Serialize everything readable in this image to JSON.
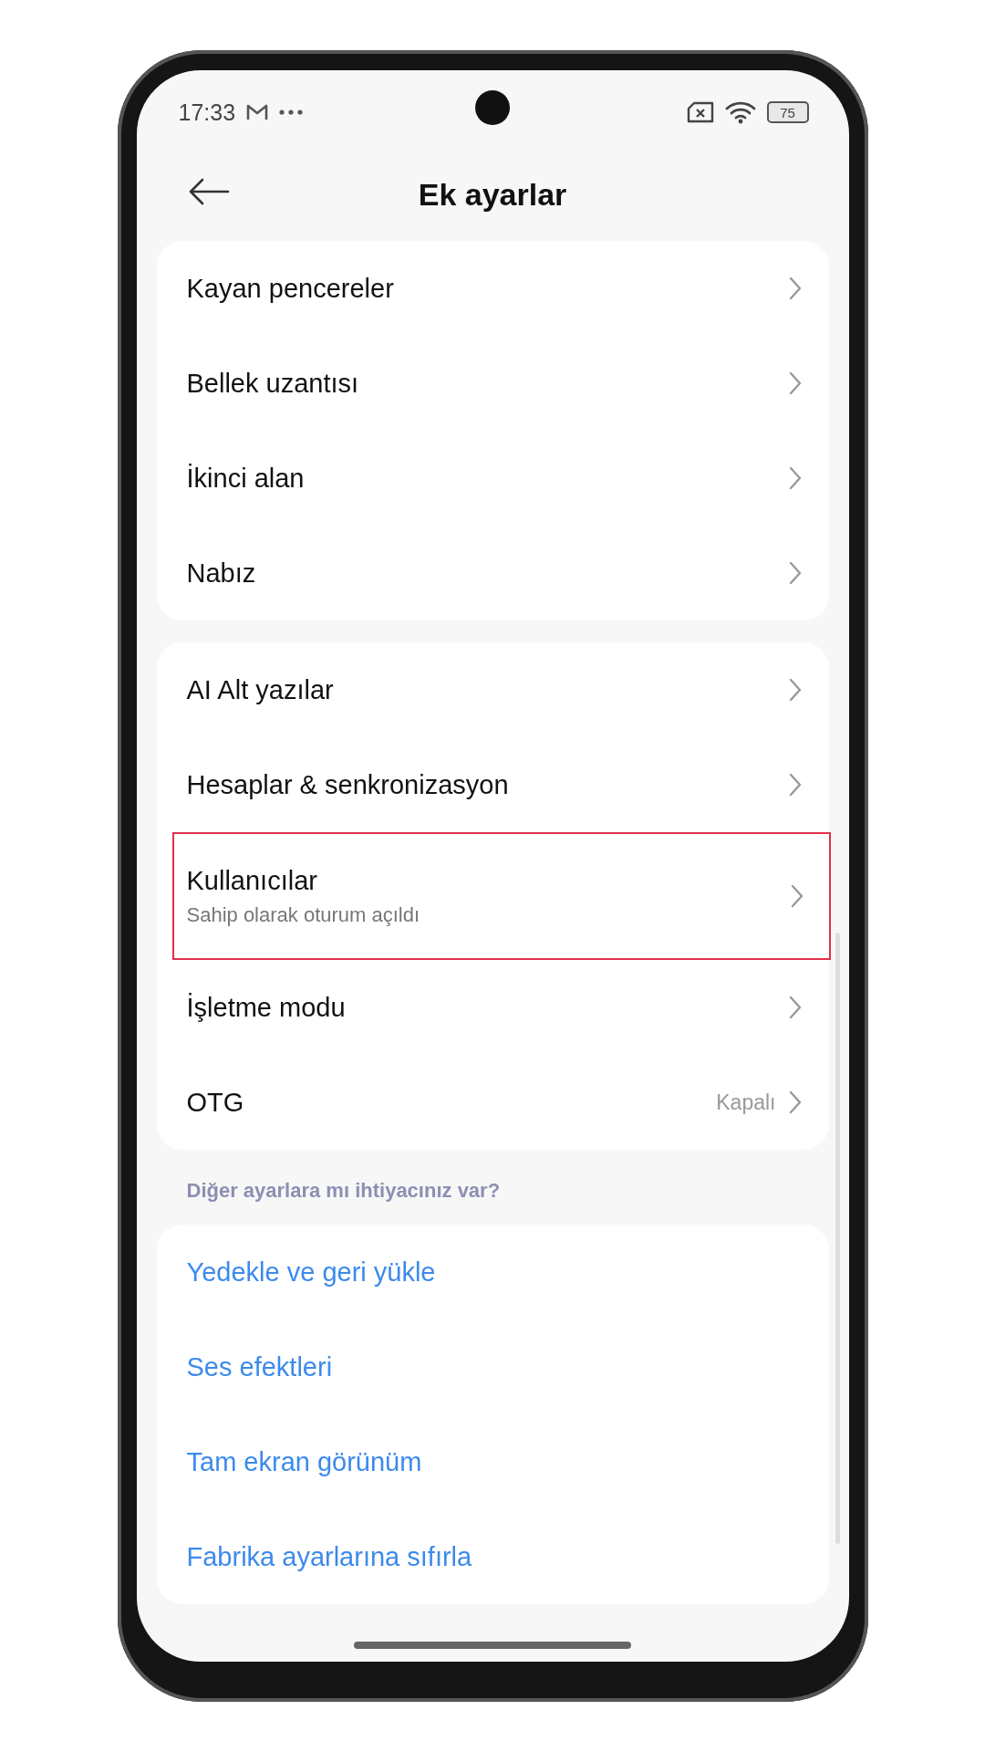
{
  "status_bar": {
    "time": "17:33",
    "battery": "75"
  },
  "header": {
    "title": "Ek ayarlar"
  },
  "groups": [
    {
      "items": [
        {
          "kind": "nav",
          "label": "Kayan pencereler",
          "highlighted": false
        },
        {
          "kind": "nav",
          "label": "Bellek uzantısı",
          "highlighted": false
        },
        {
          "kind": "nav",
          "label": "İkinci alan",
          "highlighted": false
        },
        {
          "kind": "nav",
          "label": "Nabız",
          "highlighted": false
        }
      ]
    },
    {
      "items": [
        {
          "kind": "nav",
          "label": "AI Alt yazılar",
          "highlighted": false
        },
        {
          "kind": "nav",
          "label": "Hesaplar & senkronizasyon",
          "highlighted": false
        },
        {
          "kind": "nav",
          "label": "Kullanıcılar",
          "subtitle": "Sahip olarak oturum açıldı",
          "highlighted": true
        },
        {
          "kind": "nav",
          "label": "İşletme modu",
          "highlighted": false
        },
        {
          "kind": "nav",
          "label": "OTG",
          "value": "Kapalı",
          "highlighted": false
        }
      ]
    },
    {
      "heading": "Diğer ayarlara mı ihtiyacınız var?",
      "items": [
        {
          "kind": "link",
          "label": "Yedekle ve geri yükle",
          "highlighted": false
        },
        {
          "kind": "link",
          "label": "Ses efektleri",
          "highlighted": false
        },
        {
          "kind": "link",
          "label": "Tam ekran görünüm",
          "highlighted": false
        },
        {
          "kind": "link",
          "label": "Fabrika ayarlarına sıfırla",
          "highlighted": false
        }
      ]
    }
  ]
}
